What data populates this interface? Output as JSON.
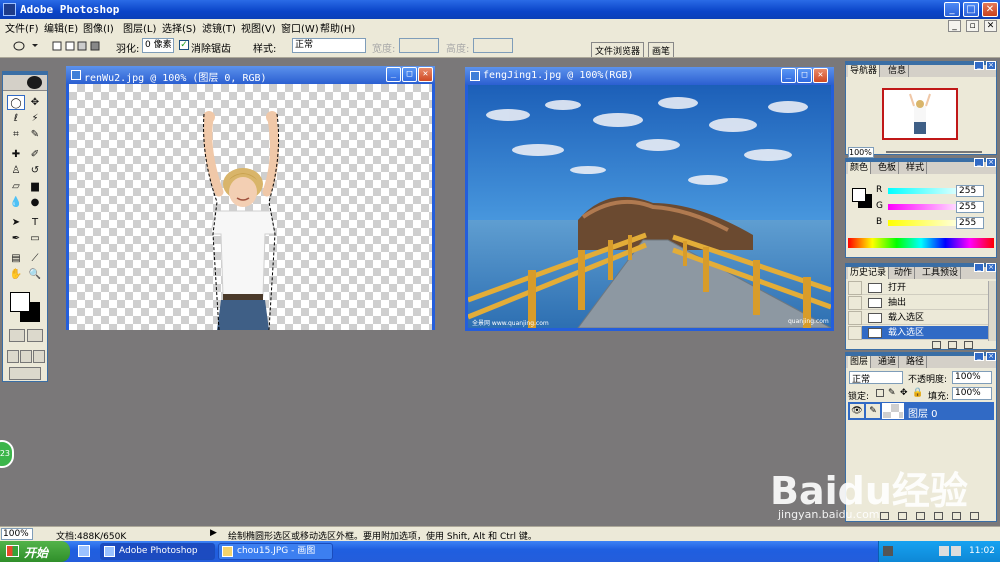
{
  "app": {
    "title": "Adobe Photoshop"
  },
  "menu": {
    "items": [
      "文件(F)",
      "编辑(E)",
      "图像(I)",
      "图层(L)",
      "选择(S)",
      "滤镜(T)",
      "视图(V)",
      "窗口(W)",
      "帮助(H)"
    ]
  },
  "options": {
    "feather_label": "羽化:",
    "feather_value": "0 像素",
    "antialias_label": "消除锯齿",
    "style_label": "样式:",
    "style_value": "正常",
    "width_label": "宽度:",
    "height_label": "高度:",
    "tab_file_browser": "文件浏览器",
    "tab_brushes": "画笔"
  },
  "docs": {
    "doc1_title": "renWu2.jpg @ 100% (图层 0, RGB)",
    "doc2_title": "fengJing1.jpg @ 100%(RGB)",
    "doc2_watermark_left": "全景网 www.quanjing.com",
    "doc2_watermark_right": "quanjing.com"
  },
  "navigator": {
    "tab1": "导航器",
    "tab2": "信息",
    "zoom": "100%"
  },
  "color": {
    "tab1": "颜色",
    "tab2": "色板",
    "tab3": "样式",
    "r_label": "R",
    "g_label": "G",
    "b_label": "B",
    "r_value": "255",
    "g_value": "255",
    "b_value": "255"
  },
  "history": {
    "tab1": "历史记录",
    "tab2": "动作",
    "tab3": "工具预设",
    "items": [
      "打开",
      "抽出",
      "载入选区",
      "载入选区"
    ]
  },
  "layers": {
    "tab1": "图层",
    "tab2": "通道",
    "tab3": "路径",
    "blend": "正常",
    "opacity_label": "不透明度:",
    "opacity": "100%",
    "lock_label": "锁定:",
    "fill_label": "填充:",
    "fill": "100%",
    "layer_name": "图层 0"
  },
  "status": {
    "zoom": "100%",
    "doc": "文档:488K/650K",
    "hint": "绘制椭圆形选区或移动选区外框。要用附加选项，使用 Shift, Alt 和 Ctrl 键。"
  },
  "taskbar": {
    "start": "开始",
    "task1": "Adobe Photoshop",
    "task2": "chou15.JPG - 画图",
    "clock": "11:02"
  },
  "overlay": {
    "badge": "23",
    "baidu": "Baidu经验",
    "baidu_url": "jingyan.baidu.com"
  },
  "colors": {
    "titlebar": "#0a44c8",
    "canvas_bg": "#7a7879",
    "selection": "#316ac5"
  }
}
